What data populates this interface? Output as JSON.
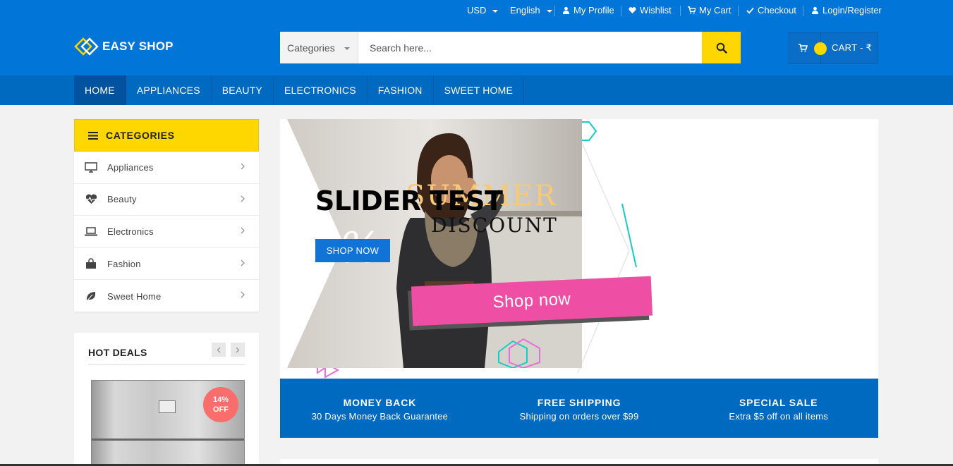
{
  "topbar": {
    "currency": "USD",
    "language": "English",
    "links": [
      "My Profile",
      "Wishlist",
      "My Cart",
      "Checkout",
      "Login/Register"
    ]
  },
  "brand": {
    "name": "EASY SHOP"
  },
  "search": {
    "category": "Categories",
    "placeholder": "Search here..."
  },
  "cart": {
    "label": "CART - ₹"
  },
  "nav": {
    "items": [
      "HOME",
      "APPLIANCES",
      "BEAUTY",
      "ELECTRONICS",
      "FASHION",
      "SWEET HOME"
    ],
    "active": "HOME"
  },
  "sidebar": {
    "title": "CATEGORIES",
    "items": [
      {
        "label": "Appliances",
        "icon": "monitor-icon"
      },
      {
        "label": "Beauty",
        "icon": "heart-pulse-icon"
      },
      {
        "label": "Electronics",
        "icon": "laptop-icon"
      },
      {
        "label": "Fashion",
        "icon": "shopping-bag-icon"
      },
      {
        "label": "Sweet Home",
        "icon": "leaf-icon"
      }
    ]
  },
  "hot_deals": {
    "title": "HOT DEALS",
    "badge_pct": "14%",
    "badge_off": "OFF"
  },
  "slider": {
    "title": "SLIDER TEST",
    "summer": "SUMMER",
    "discount": "DISCOUNT",
    "percent": "75%",
    "button": "SHOP NOW",
    "banner_cta": "Shop now"
  },
  "features": [
    {
      "title": "MONEY BACK",
      "subtitle": "30 Days Money Back Guarantee"
    },
    {
      "title": "FREE SHIPPING",
      "subtitle": "Shipping on orders over $99"
    },
    {
      "title": "SPECIAL SALE",
      "subtitle": "Extra $5 off on all items"
    }
  ],
  "colors": {
    "primary": "#0275d8",
    "nav": "#0069c0",
    "accent": "#fed700",
    "badge": "#f96d6d",
    "pink": "#ef4ea5",
    "teal": "#19cbc5"
  }
}
